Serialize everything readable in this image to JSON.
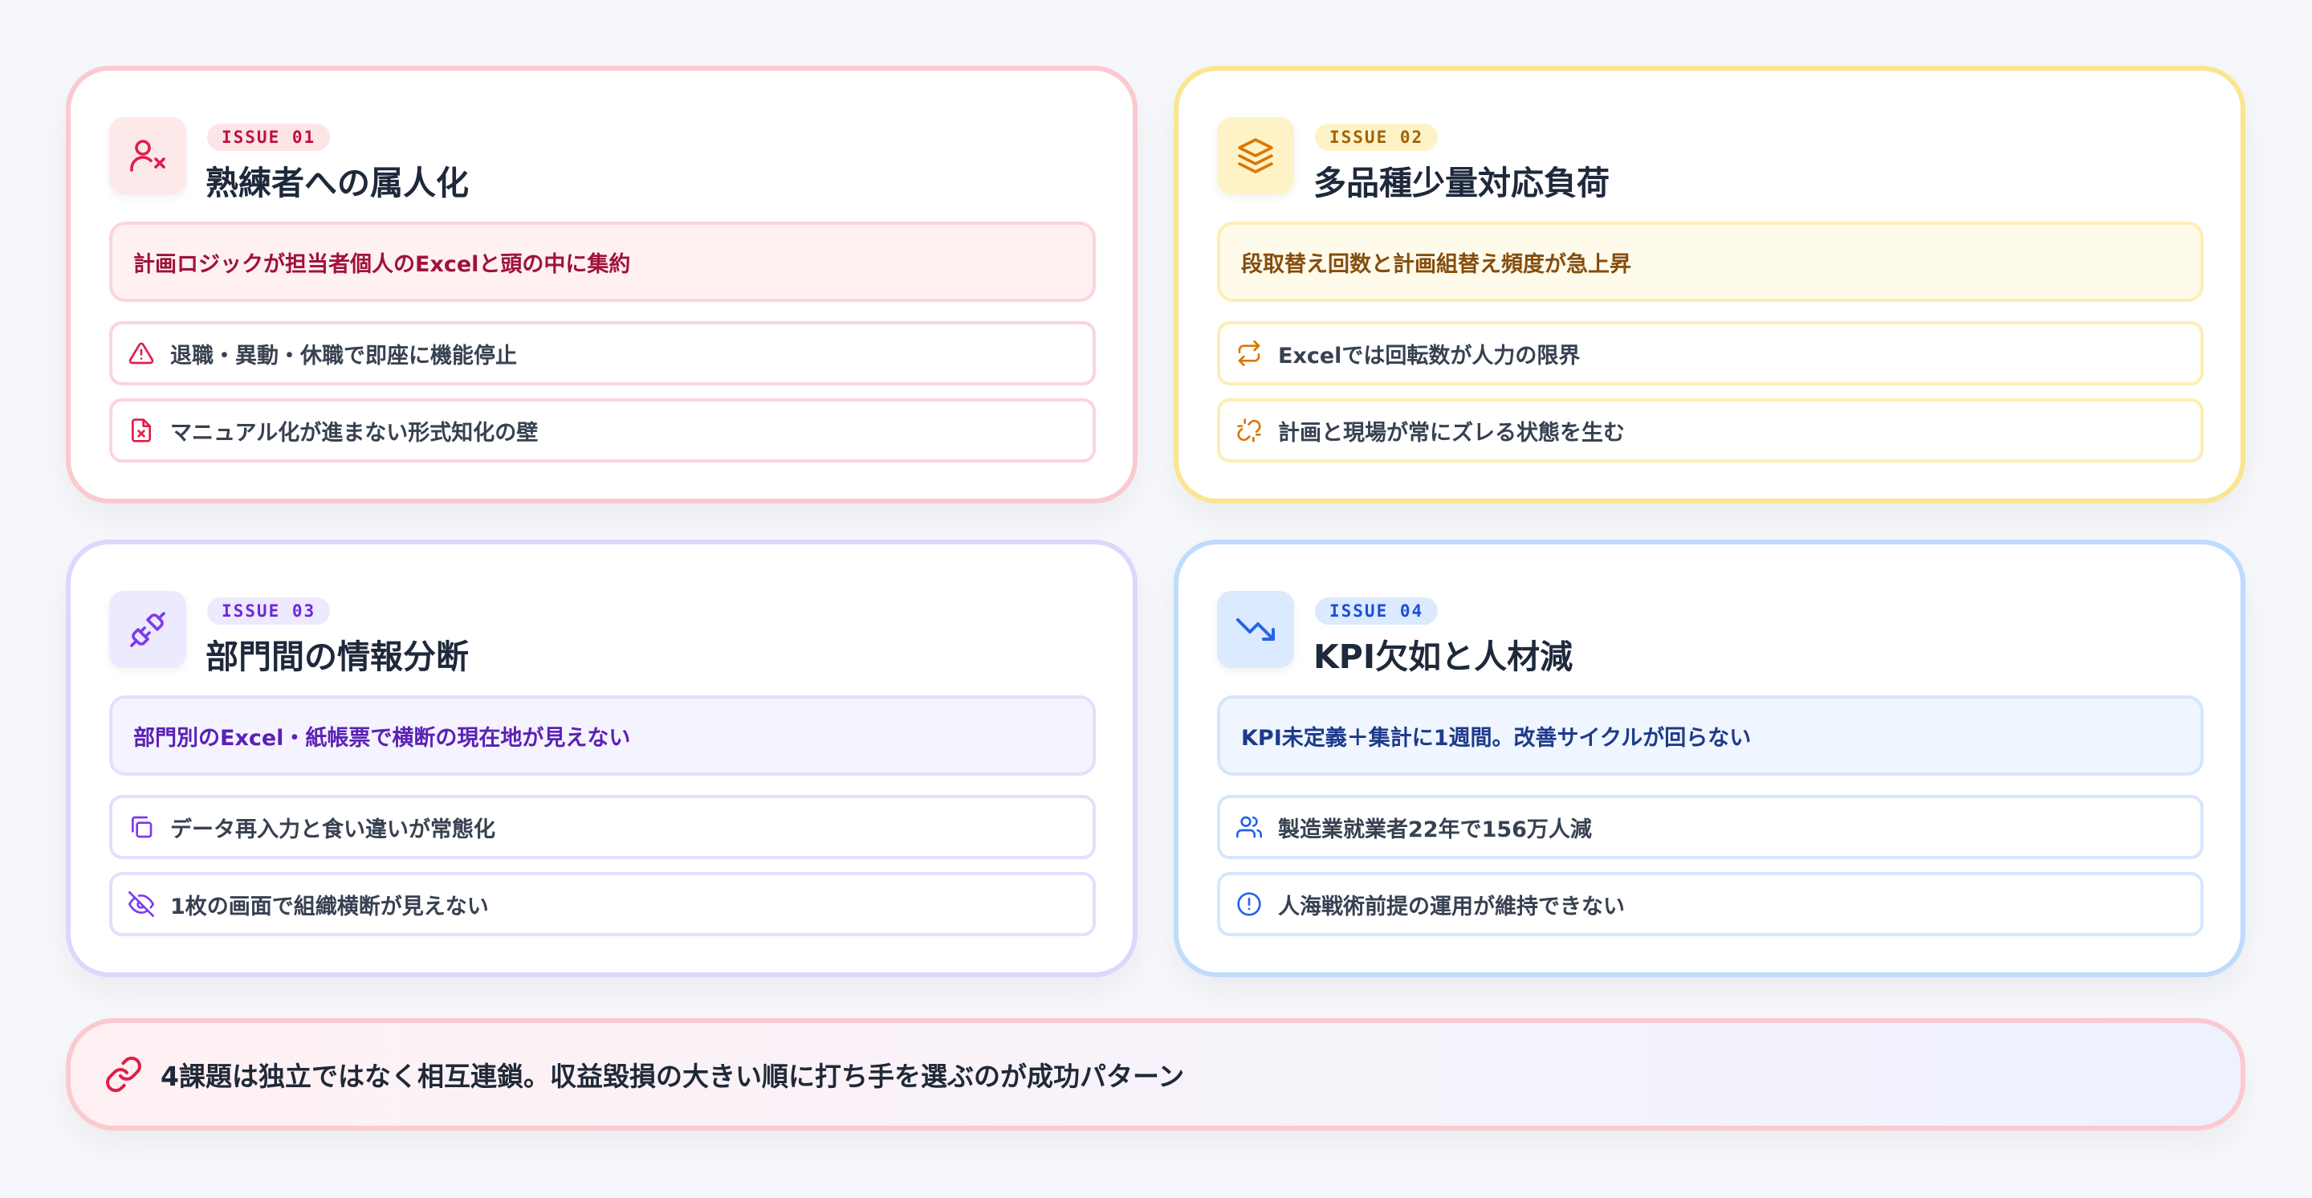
{
  "cards": [
    {
      "badge": "ISSUE 01",
      "icon": "user-x-icon",
      "title": "熟練者への属人化",
      "summary": "計画ロジックが担当者個人のExcelと頭の中に集約",
      "items": [
        {
          "icon": "alert-triangle-icon",
          "text": "退職・異動・休職で即座に機能停止"
        },
        {
          "icon": "file-x-icon",
          "text": "マニュアル化が進まない形式知化の壁"
        }
      ],
      "accent": "#e11d48"
    },
    {
      "badge": "ISSUE 02",
      "icon": "layers-icon",
      "title": "多品種少量対応負荷",
      "summary": "段取替え回数と計画組替え頻度が急上昇",
      "items": [
        {
          "icon": "repeat-icon",
          "text": "Excelでは回転数が人力の限界"
        },
        {
          "icon": "unlink-icon",
          "text": "計画と現場が常にズレる状態を生む"
        }
      ],
      "accent": "#d97706"
    },
    {
      "badge": "ISSUE 03",
      "icon": "plug-unplugged-icon",
      "title": "部門間の情報分断",
      "summary": "部門別のExcel・紙帳票で横断の現在地が見えない",
      "items": [
        {
          "icon": "copy-icon",
          "text": "データ再入力と食い違いが常態化"
        },
        {
          "icon": "eye-off-icon",
          "text": "1枚の画面で組織横断が見えない"
        }
      ],
      "accent": "#7c3aed"
    },
    {
      "badge": "ISSUE 04",
      "icon": "trending-down-icon",
      "title": "KPI欠如と人材減",
      "summary": "KPI未定義＋集計に1週間。改善サイクルが回らない",
      "items": [
        {
          "icon": "users-icon",
          "text": "製造業就業者22年で156万人減"
        },
        {
          "icon": "alert-circle-icon",
          "text": "人海戦術前提の運用が維持できない"
        }
      ],
      "accent": "#2563eb"
    }
  ],
  "footer": {
    "icon": "link-icon",
    "text": "4課題は独立ではなく相互連鎖。収益毀損の大きい順に打ち手を選ぶのが成功パターン",
    "accent": "#e11d48"
  }
}
